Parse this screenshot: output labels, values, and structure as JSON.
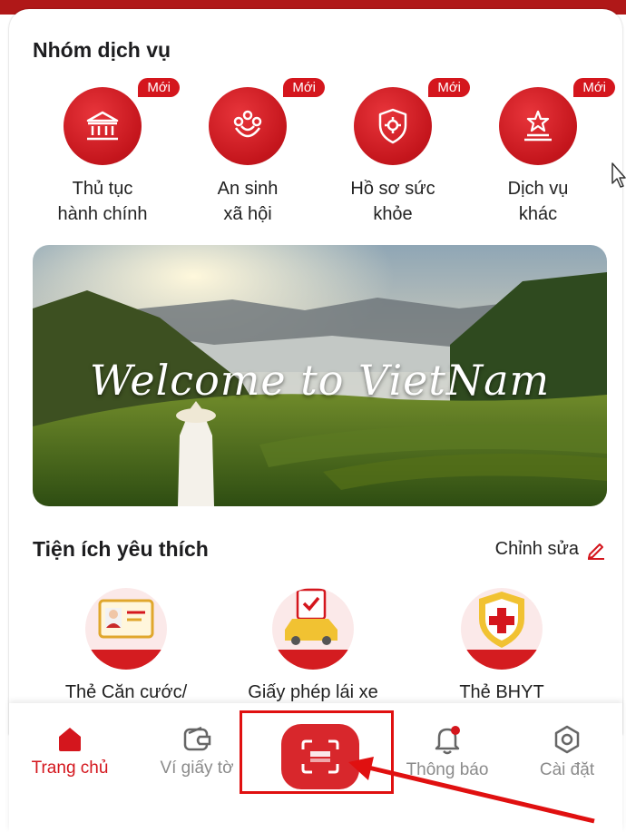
{
  "services": {
    "title": "Nhóm dịch vụ",
    "items": [
      {
        "line1": "Thủ tục",
        "line2": "hành chính",
        "badge": "Mới",
        "icon": "government-building-icon"
      },
      {
        "line1": "An sinh",
        "line2": "xã hội",
        "badge": "Mới",
        "icon": "social-welfare-icon"
      },
      {
        "line1": "Hồ sơ sức",
        "line2": "khỏe",
        "badge": "Mới",
        "icon": "health-shield-icon"
      },
      {
        "line1": "Dịch vụ",
        "line2": "khác",
        "badge": "Mới",
        "icon": "star-podium-icon"
      }
    ]
  },
  "banner": {
    "text": "Welcome to VietNam"
  },
  "favorites": {
    "title": "Tiện ích yêu thích",
    "edit_label": "Chỉnh sửa",
    "items": [
      {
        "label": "Thẻ Căn cước/",
        "icon": "id-card-icon"
      },
      {
        "label": "Giấy phép lái xe",
        "icon": "driver-license-car-icon"
      },
      {
        "label": "Thẻ BHYT",
        "icon": "health-insurance-shield-icon"
      }
    ]
  },
  "bottom_nav": {
    "items": [
      {
        "label": "Trang chủ",
        "icon": "home-icon",
        "active": true
      },
      {
        "label": "Ví giấy tờ",
        "icon": "wallet-icon",
        "active": false
      },
      {
        "label": "",
        "icon": "scan-icon",
        "active": false
      },
      {
        "label": "Thông báo",
        "icon": "bell-icon",
        "active": false
      },
      {
        "label": "Cài đặt",
        "icon": "settings-icon",
        "active": false
      }
    ]
  },
  "colors": {
    "accent": "#d4161d",
    "inactive": "#8b8b8b",
    "annotation": "#e01010"
  }
}
